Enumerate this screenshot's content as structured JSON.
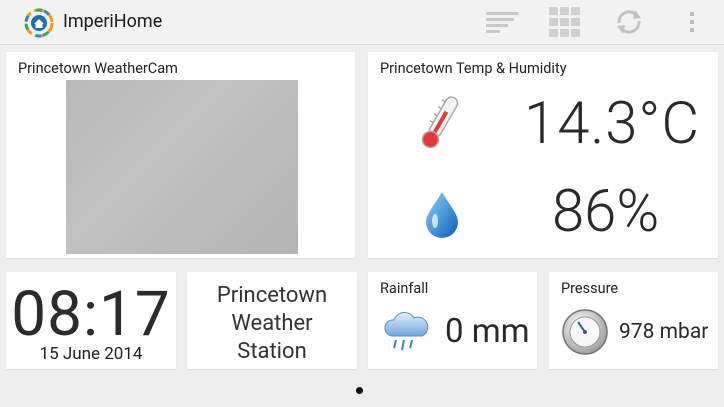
{
  "app": {
    "title": "ImperiHome"
  },
  "toolbar": {
    "icons": [
      "list-view-icon",
      "grid-view-icon",
      "refresh-icon",
      "overflow-menu-icon"
    ]
  },
  "tiles": {
    "webcam": {
      "title": "Princetown WeatherCam"
    },
    "temp_humidity": {
      "title": "Princetown Temp & Humidity",
      "temperature": "14.3°C",
      "humidity": "86%"
    },
    "clock": {
      "time": "08:17",
      "date": "15 June 2014"
    },
    "station": {
      "line1": "Princetown",
      "line2": "Weather",
      "line3": "Station"
    },
    "rainfall": {
      "title": "Rainfall",
      "value": "0 mm"
    },
    "pressure": {
      "title": "Pressure",
      "value": "978 mbar"
    }
  },
  "pager": {
    "current_page": 1,
    "total_pages": 1
  },
  "colors": {
    "background": "#eeeeee",
    "tile": "#ffffff",
    "topbar": "#f2f2f2"
  }
}
